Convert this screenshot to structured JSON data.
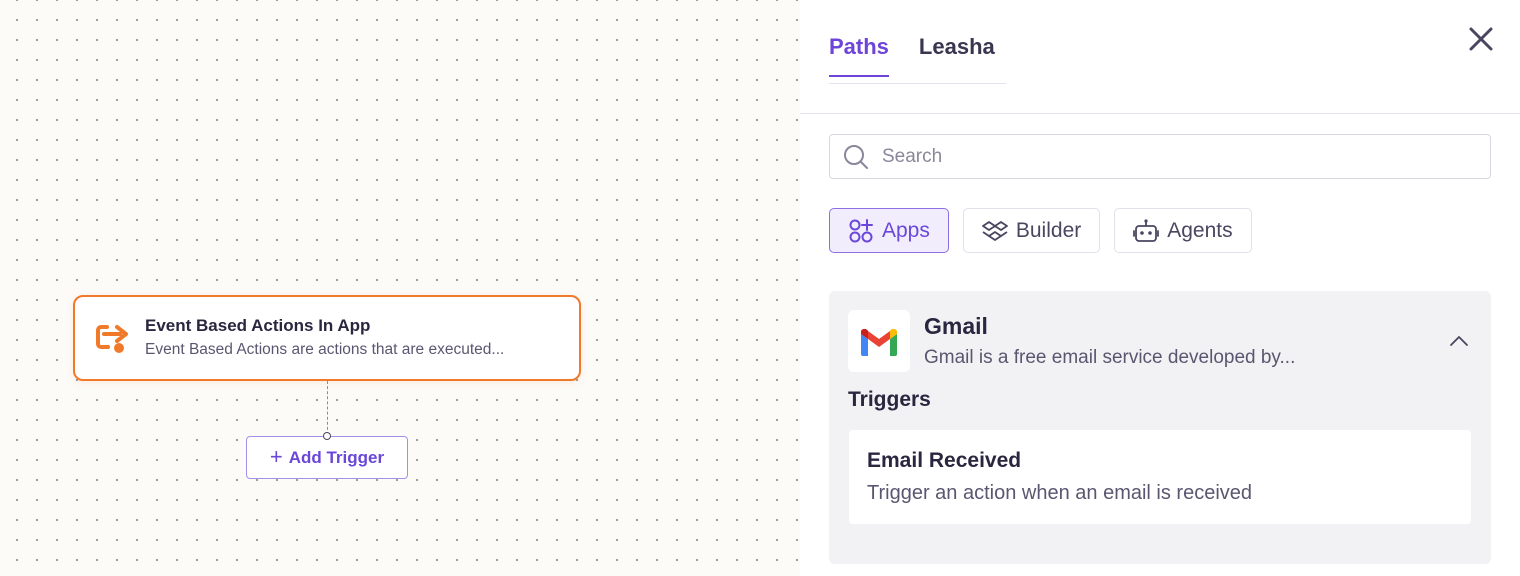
{
  "canvas": {
    "node": {
      "title": "Event Based Actions In App",
      "description": "Event Based Actions are actions that are executed...",
      "icon": "event-redirect-icon",
      "accent_color": "#f07a2a"
    },
    "add_trigger": {
      "plus": "+",
      "label": "Add Trigger"
    }
  },
  "panel": {
    "tabs": [
      {
        "label": "Paths",
        "active": true
      },
      {
        "label": "Leasha",
        "active": false
      }
    ],
    "close_icon": "close-icon",
    "search": {
      "placeholder": "Search",
      "value": ""
    },
    "filters": [
      {
        "label": "Apps",
        "icon": "apps-icon",
        "active": true
      },
      {
        "label": "Builder",
        "icon": "builder-icon",
        "active": false
      },
      {
        "label": "Agents",
        "icon": "robot-icon",
        "active": false
      }
    ],
    "app": {
      "name": "Gmail",
      "description": "Gmail is a free email service developed by...",
      "logo": "gmail-logo",
      "expanded": true,
      "triggers_heading": "Triggers",
      "triggers": [
        {
          "title": "Email Received",
          "description": "Trigger an action when an email is received"
        }
      ]
    },
    "accent_color": "#6e44d9"
  }
}
